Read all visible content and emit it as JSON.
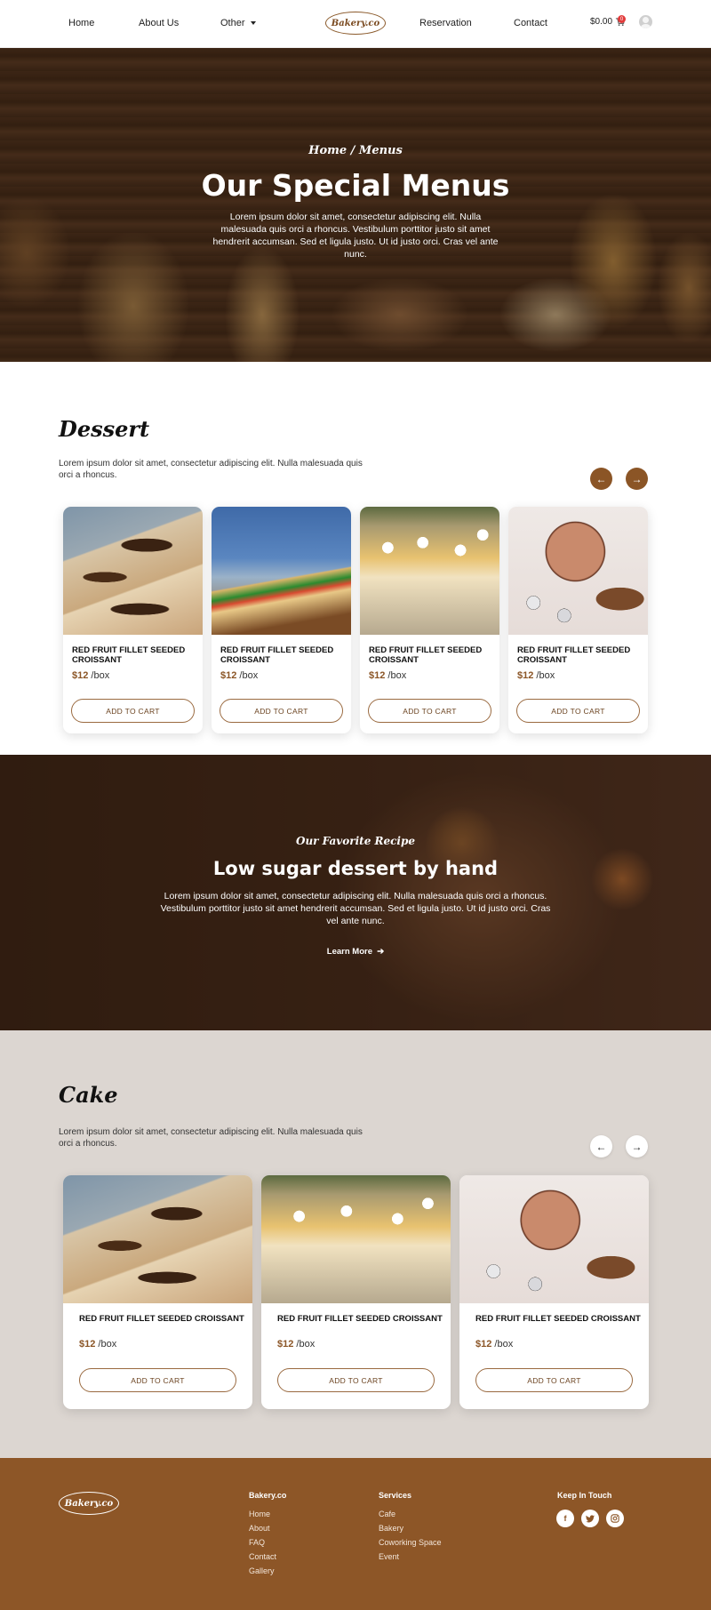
{
  "nav": {
    "home": "Home",
    "about": "About Us",
    "other": "Other",
    "logo": "Bakery.co",
    "reservation": "Reservation",
    "contact": "Contact",
    "cart_total": "$0.00",
    "cart_count": "0"
  },
  "hero": {
    "breadcrumb": "Home / Menus",
    "title": "Our Special Menus",
    "text": "Lorem ipsum dolor sit amet, consectetur adipiscing elit. Nulla malesuada quis orci a rhoncus. Vestibulum porttitor justo sit amet hendrerit accumsan. Sed et ligula justo. Ut id justo orci. Cras vel ante nunc."
  },
  "dessert": {
    "title": "Dessert",
    "text": "Lorem ipsum dolor sit amet, consectetur adipiscing elit. Nulla malesuada quis orci a rhoncus.",
    "cards": [
      {
        "name": "RED FRUIT FILLET SEEDED CROISSANT",
        "price": "$12",
        "unit": "/box",
        "button": "ADD TO CART"
      },
      {
        "name": "RED FRUIT FILLET SEEDED CROISSANT",
        "price": "$12",
        "unit": "/box",
        "button": "ADD TO CART"
      },
      {
        "name": "RED FRUIT FILLET SEEDED CROISSANT",
        "price": "$12",
        "unit": "/box",
        "button": "ADD TO CART"
      },
      {
        "name": "RED FRUIT FILLET SEEDED CROISSANT",
        "price": "$12",
        "unit": "/box",
        "button": "ADD TO CART"
      }
    ]
  },
  "banner": {
    "subtitle": "Our Favorite Recipe",
    "title": "Low sugar dessert by hand",
    "text": "Lorem ipsum dolor sit amet, consectetur adipiscing elit. Nulla malesuada quis orci a rhoncus. Vestibulum porttitor justo sit amet hendrerit accumsan. Sed et ligula justo. Ut id justo orci. Cras vel ante nunc.",
    "link": "Learn More"
  },
  "cake": {
    "title": "Cake",
    "text": "Lorem ipsum dolor sit amet, consectetur adipiscing elit. Nulla malesuada quis orci a rhoncus.",
    "cards": [
      {
        "name": "RED FRUIT FILLET SEEDED CROISSANT",
        "price": "$12",
        "unit": "/box",
        "button": "ADD TO CART"
      },
      {
        "name": "RED FRUIT FILLET SEEDED CROISSANT",
        "price": "$12",
        "unit": "/box",
        "button": "ADD TO CART"
      },
      {
        "name": "RED FRUIT FILLET SEEDED CROISSANT",
        "price": "$12",
        "unit": "/box",
        "button": "ADD TO CART"
      }
    ]
  },
  "footer": {
    "logo": "Bakery.co",
    "col1_title": "Bakery.co",
    "col1_links": [
      "Home",
      "About",
      "FAQ",
      "Contact",
      "Gallery"
    ],
    "col2_title": "Services",
    "col2_links": [
      "Cafe",
      "Bakery",
      "Coworking Space",
      "Event"
    ],
    "col3_title": "Keep In Touch",
    "social": [
      "facebook-icon",
      "twitter-icon",
      "instagram-icon"
    ]
  },
  "colors": {
    "accent": "#8b5526",
    "footer": "#8d5627",
    "cake_bg": "#dcd6d1"
  }
}
